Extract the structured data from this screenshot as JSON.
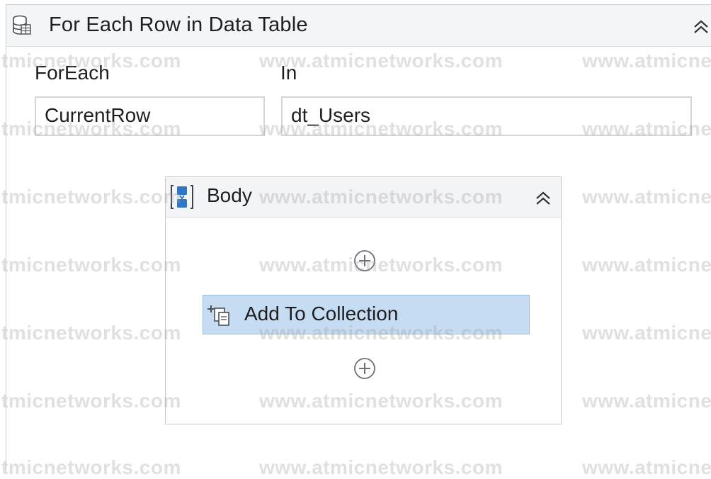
{
  "container": {
    "title": "For Each Row in Data Table",
    "icon": "data-table-icon",
    "collapse_icon": "double-chevron-up-icon"
  },
  "fields": {
    "foreach_label": "ForEach",
    "foreach_value": "CurrentRow",
    "in_label": "In",
    "in_value": "dt_Users"
  },
  "body": {
    "title": "Body",
    "icon": "sequence-icon",
    "collapse_icon": "double-chevron-up-icon",
    "add_activity_icon": "add-circle-icon",
    "activities": [
      {
        "label": "Add To Collection",
        "icon": "add-to-collection-icon",
        "selected": true
      }
    ]
  },
  "watermarks": [
    "tmicnetworks.com",
    "www.atmicnetworks.com",
    "www.atmicne"
  ],
  "colors": {
    "selected_activity": "#c6dcf2",
    "selected_border": "#9dbfe2",
    "header_bg": "#f4f5f7"
  }
}
